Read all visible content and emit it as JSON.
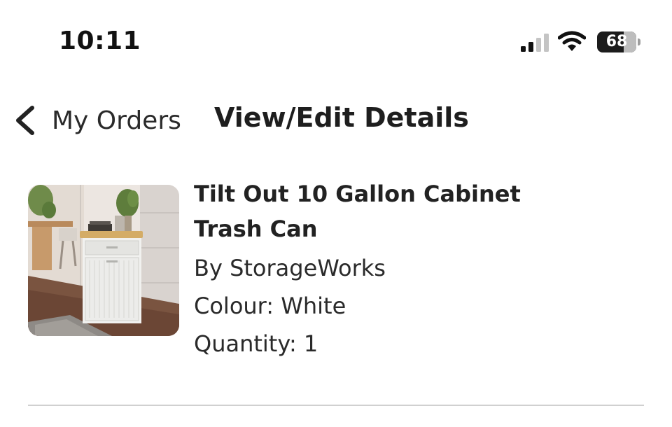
{
  "status_bar": {
    "time": "10:11",
    "battery_level": "68",
    "icons": [
      "cellular-signal-icon",
      "wifi-icon",
      "battery-icon"
    ]
  },
  "nav": {
    "back_label": "My Orders",
    "back_icon": "chevron-left-icon",
    "title": "View/Edit Details"
  },
  "product": {
    "title_line1": "Tilt Out 10 Gallon Cabinet",
    "title_line2": "Trash Can",
    "brand": "By StorageWorks",
    "colour": "Colour: White",
    "quantity": "Quantity: 1"
  },
  "colors": {
    "text_primary": "#1f1f1f",
    "divider": "#d0d0d0",
    "background": "#ffffff"
  }
}
